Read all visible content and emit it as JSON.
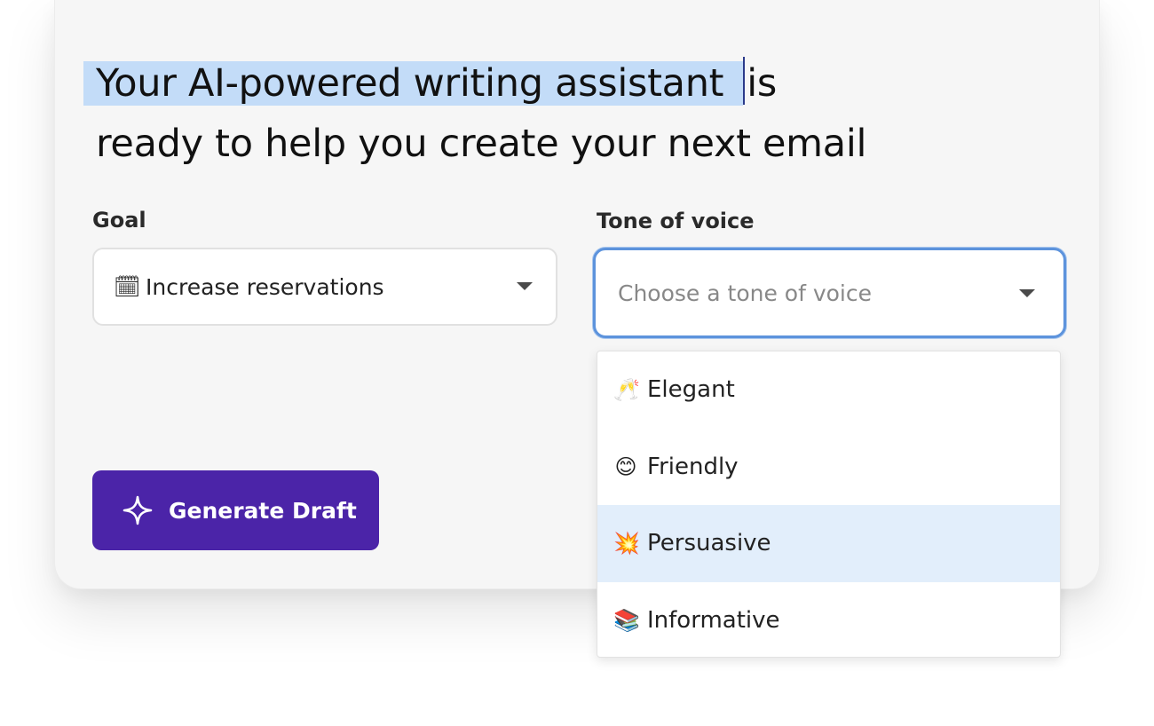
{
  "headline": {
    "highlighted": "Your AI-powered writing assistant",
    "rest_line1": "is",
    "line2": "ready to help you create your next email"
  },
  "goal": {
    "label": "Goal",
    "icon": "calendar-icon",
    "value": "Increase reservations"
  },
  "tone": {
    "label": "Tone of voice",
    "placeholder": "Choose a tone of voice",
    "options": [
      {
        "emoji": "🥂",
        "icon": "clinking-glasses-icon",
        "label": "Elegant"
      },
      {
        "emoji": "😊",
        "icon": "smiling-face-icon",
        "label": "Friendly"
      },
      {
        "emoji": "💥",
        "icon": "collision-icon",
        "label": "Persuasive"
      },
      {
        "emoji": "📚",
        "icon": "books-icon",
        "label": "Informative"
      }
    ],
    "highlighted_option": "Persuasive"
  },
  "actions": {
    "generate_label": "Generate Draft",
    "generate_icon": "sparkle-icon"
  },
  "colors": {
    "primary_button": "#4b24a8",
    "focus_border": "#5d93dc",
    "text_highlight": "#c3dcf8",
    "option_hover": "#e2eefb"
  }
}
